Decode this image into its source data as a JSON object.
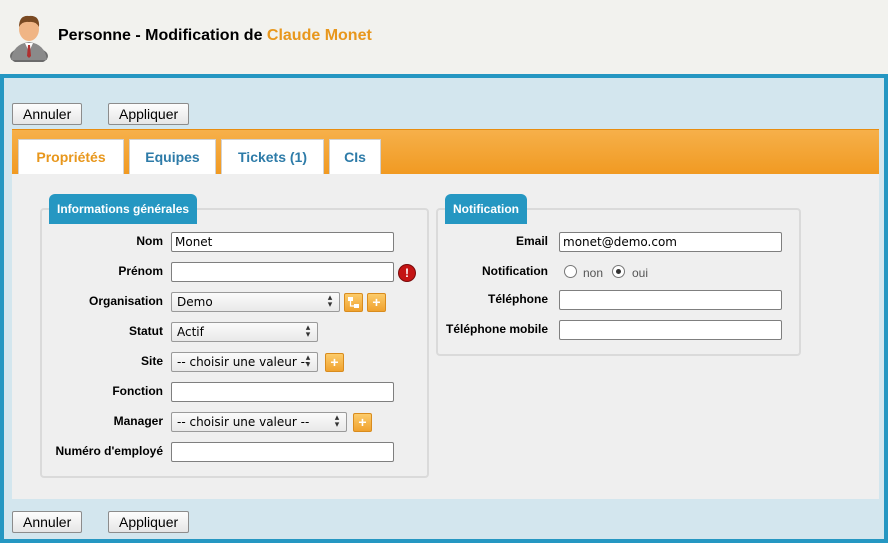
{
  "header": {
    "title_prefix": "Personne - Modification de ",
    "title_name": "Claude Monet"
  },
  "toolbar_top": {
    "cancel_label": "Annuler",
    "apply_label": "Appliquer"
  },
  "toolbar_bottom": {
    "cancel_label": "Annuler",
    "apply_label": "Appliquer"
  },
  "tabs": [
    {
      "label": "Propriétés",
      "active": true
    },
    {
      "label": "Equipes"
    },
    {
      "label": "Tickets (1)"
    },
    {
      "label": "CIs"
    }
  ],
  "general": {
    "legend": "Informations générales",
    "nom": {
      "label": "Nom",
      "value": "Monet"
    },
    "prenom": {
      "label": "Prénom",
      "value": ""
    },
    "organisation": {
      "label": "Organisation",
      "value": "Demo"
    },
    "statut": {
      "label": "Statut",
      "value": "Actif"
    },
    "site": {
      "label": "Site",
      "value": "-- choisir une valeur --"
    },
    "fonction": {
      "label": "Fonction",
      "value": ""
    },
    "manager": {
      "label": "Manager",
      "value": "-- choisir une valeur --"
    },
    "employe": {
      "label": "Numéro d'employé",
      "value": ""
    }
  },
  "notification": {
    "legend": "Notification",
    "email": {
      "label": "Email",
      "value": "monet@demo.com"
    },
    "notif": {
      "label": "Notification",
      "option_non": "non",
      "option_oui": "oui",
      "selected": "oui"
    },
    "telephone": {
      "label": "Téléphone",
      "value": ""
    },
    "mobile": {
      "label": "Téléphone mobile",
      "value": ""
    }
  },
  "icons": {
    "add": "+",
    "error": "!",
    "colors": {
      "accent": "#e8971c",
      "frame": "#2597c2",
      "tabbar": "#f19a22",
      "error": "#c41414"
    }
  }
}
